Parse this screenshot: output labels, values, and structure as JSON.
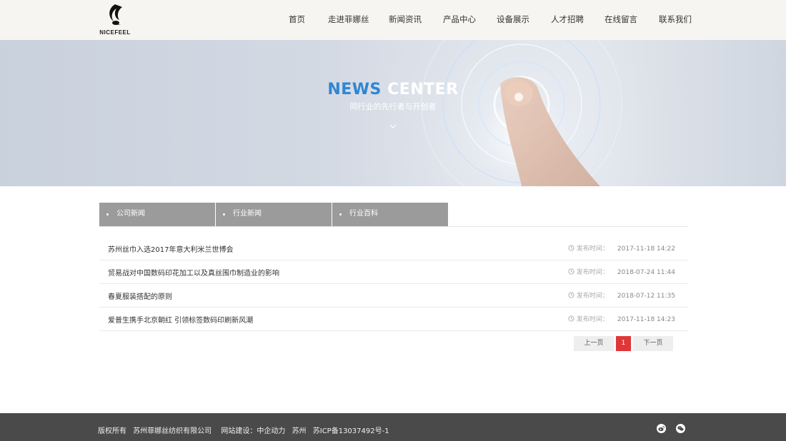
{
  "header": {
    "logo_text": "NICEFEEL",
    "nav": [
      "首页",
      "走进菲娜丝",
      "新闻资讯",
      "产品中心",
      "设备展示",
      "人才招聘",
      "在线留言",
      "联系我们"
    ]
  },
  "banner": {
    "title_part1": "NEWS",
    "title_part2": "CENTER",
    "subtitle": "同行业的先行者与开创者"
  },
  "tabs": [
    "公司新闻",
    "行业新闻",
    "行业百科"
  ],
  "news": {
    "time_label": "发布时间：",
    "items": [
      {
        "title": "苏州丝巾入选2017年意大利米兰世博会",
        "date": "2017-11-18 14:22"
      },
      {
        "title": "贸易战对中国数码印花加工以及真丝围巾制造业的影响",
        "date": "2018-07-24 11:44"
      },
      {
        "title": "春夏服装搭配的原则",
        "date": "2018-07-12 11:35"
      },
      {
        "title": "爱普生携手北京朝红 引领标签数码印刷新风潮",
        "date": "2017-11-18 14:23"
      }
    ]
  },
  "pagination": {
    "prev": "上一页",
    "current": "1",
    "next": "下一页"
  },
  "footer": {
    "copyright": "版权所有",
    "company": "苏州菲娜丝纺织有限公司",
    "builder": "网站建设：中企动力",
    "city": "苏州",
    "icp": "苏ICP备13037492号-1"
  },
  "colors": {
    "accent_red": "#e0363a",
    "title_blue": "#2f86d2",
    "tab_gray": "#9b9b9b",
    "footer_bg": "#4a4a4a"
  },
  "icons": {
    "footer": [
      "weibo-icon",
      "wechat-icon"
    ],
    "news": "clock-icon",
    "banner": "chevron-down-icon"
  }
}
